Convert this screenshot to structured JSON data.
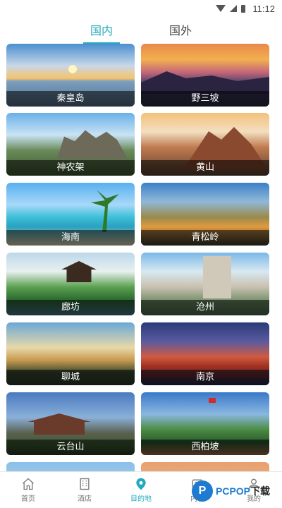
{
  "status_bar": {
    "time": "11:12"
  },
  "tabs": [
    {
      "label": "国内",
      "active": true
    },
    {
      "label": "国外",
      "active": false
    }
  ],
  "destinations": [
    {
      "name": "秦皇岛"
    },
    {
      "name": "野三坡"
    },
    {
      "name": "神农架"
    },
    {
      "name": "黄山"
    },
    {
      "name": "海南"
    },
    {
      "name": "青松岭"
    },
    {
      "name": "廊坊"
    },
    {
      "name": "沧州"
    },
    {
      "name": "聊城"
    },
    {
      "name": "南京"
    },
    {
      "name": "云台山"
    },
    {
      "name": "西柏坡"
    }
  ],
  "bottom_nav": [
    {
      "label": "首页",
      "icon": "home-icon"
    },
    {
      "label": "酒店",
      "icon": "hotel-icon"
    },
    {
      "label": "目的地",
      "icon": "location-pin-icon",
      "active": true
    },
    {
      "label": "内容",
      "icon": "content-icon"
    },
    {
      "label": "我的",
      "icon": "profile-icon"
    }
  ],
  "watermark": {
    "logo": "P",
    "brand": "PCPOP",
    "suffix": "下载"
  },
  "colors": {
    "accent": "#21a9bd",
    "text": "#444444"
  }
}
